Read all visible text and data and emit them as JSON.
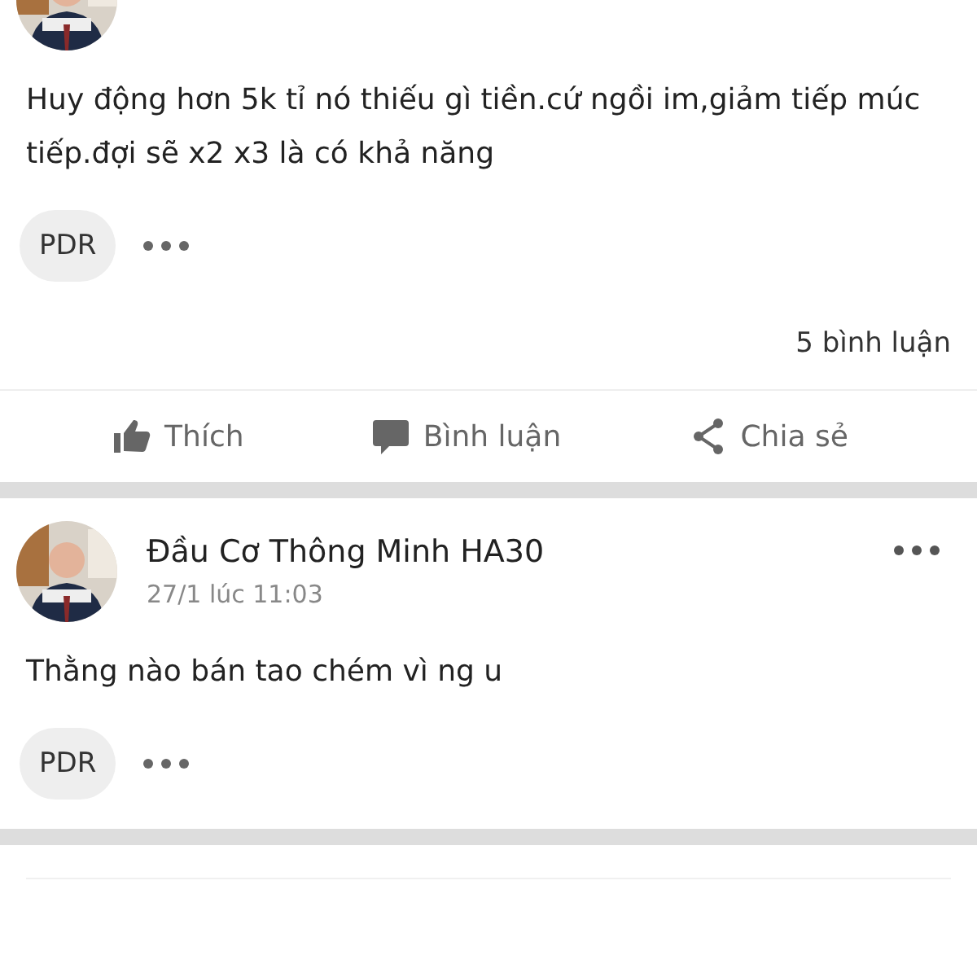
{
  "posts": [
    {
      "body": "Huy động hơn 5k tỉ nó thiếu gì tiền.cứ ngồi im,giảm tiếp múc tiếp.đợi sẽ x2 x3 là có khả năng",
      "tag": "PDR",
      "comment_count": "5 bình luận",
      "actions": [
        {
          "kind": "like",
          "label": "Thích"
        },
        {
          "kind": "comment",
          "label": "Bình luận"
        },
        {
          "kind": "share",
          "label": "Chia sẻ"
        }
      ]
    },
    {
      "author": "Đầu Cơ Thông Minh HA30",
      "time": "27/1 lúc 11:03",
      "body": "Thằng nào bán tao chém vì ng u",
      "tag": "PDR"
    }
  ]
}
